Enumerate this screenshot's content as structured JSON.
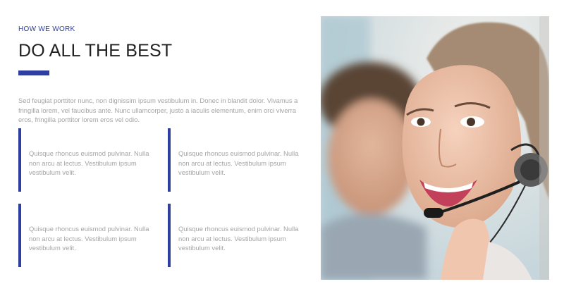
{
  "section": {
    "eyebrow": "HOW WE WORK",
    "title": "DO ALL THE BEST",
    "intro": "Sed feugiat porttitor nunc, non dignissim ipsum vestibulum in. Donec in blandit dolor. Vivamus a fringilla lorem, vel faucibus ante. Nunc ullamcorper, justo a iaculis elementum, enim orci viverra eros, fringilla porttitor lorem eros vel odio."
  },
  "features": [
    {
      "text": "Quisque rhoncus euismod pulvinar. Nulla non arcu at lectus. Vestibulum ipsum vestibulum velit."
    },
    {
      "text": "Quisque rhoncus euismod pulvinar. Nulla non arcu at lectus. Vestibulum ipsum vestibulum velit."
    },
    {
      "text": "Quisque rhoncus euismod pulvinar. Nulla non arcu at lectus. Vestibulum ipsum vestibulum velit."
    },
    {
      "text": "Quisque rhoncus euismod pulvinar. Nulla non arcu at lectus. Vestibulum ipsum vestibulum velit."
    }
  ],
  "colors": {
    "accent": "#2f3fa0",
    "heading": "#222222",
    "body_text": "#a4a4a4"
  },
  "photo": {
    "icon": "support-agent-photo"
  }
}
